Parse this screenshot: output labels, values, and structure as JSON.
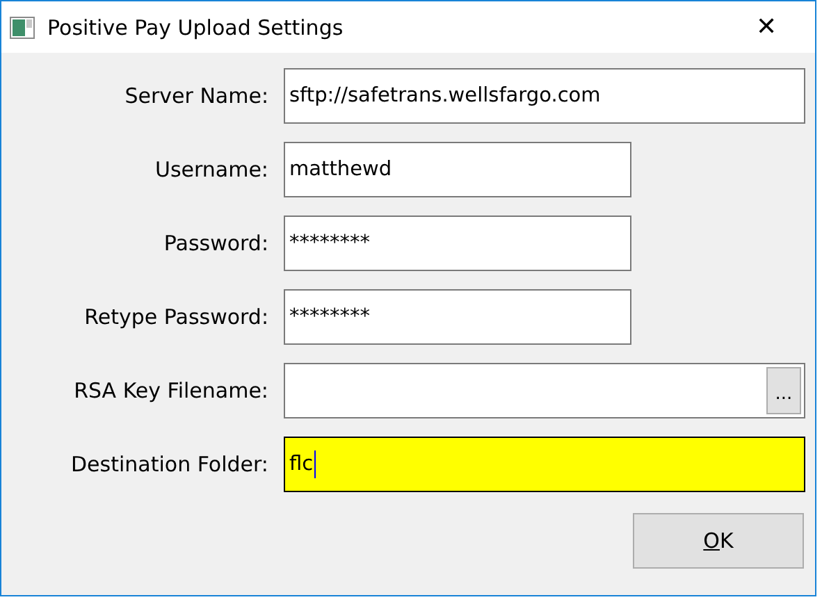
{
  "window": {
    "title": "Positive Pay Upload Settings",
    "close": "✕"
  },
  "fields": [
    {
      "kind": "long",
      "label": "Server Name:",
      "value": "sftp://safetrans.wellsfargo.com",
      "highlighted": false,
      "focused": false
    },
    {
      "kind": "short",
      "label": "Username:",
      "value": "matthewd",
      "highlighted": false,
      "focused": false
    },
    {
      "kind": "short",
      "label": "Password:",
      "value": "********",
      "highlighted": false,
      "focused": false
    },
    {
      "kind": "short",
      "label": "Retype Password:",
      "value": "********",
      "highlighted": false,
      "focused": false
    },
    {
      "kind": "file",
      "label": "RSA Key Filename:",
      "browse": "...",
      "highlighted": false,
      "focused": false
    },
    {
      "kind": "long",
      "label": "Destination Folder:",
      "value": "flc",
      "highlighted": true,
      "focused": true
    }
  ],
  "buttons": [
    "OK"
  ]
}
